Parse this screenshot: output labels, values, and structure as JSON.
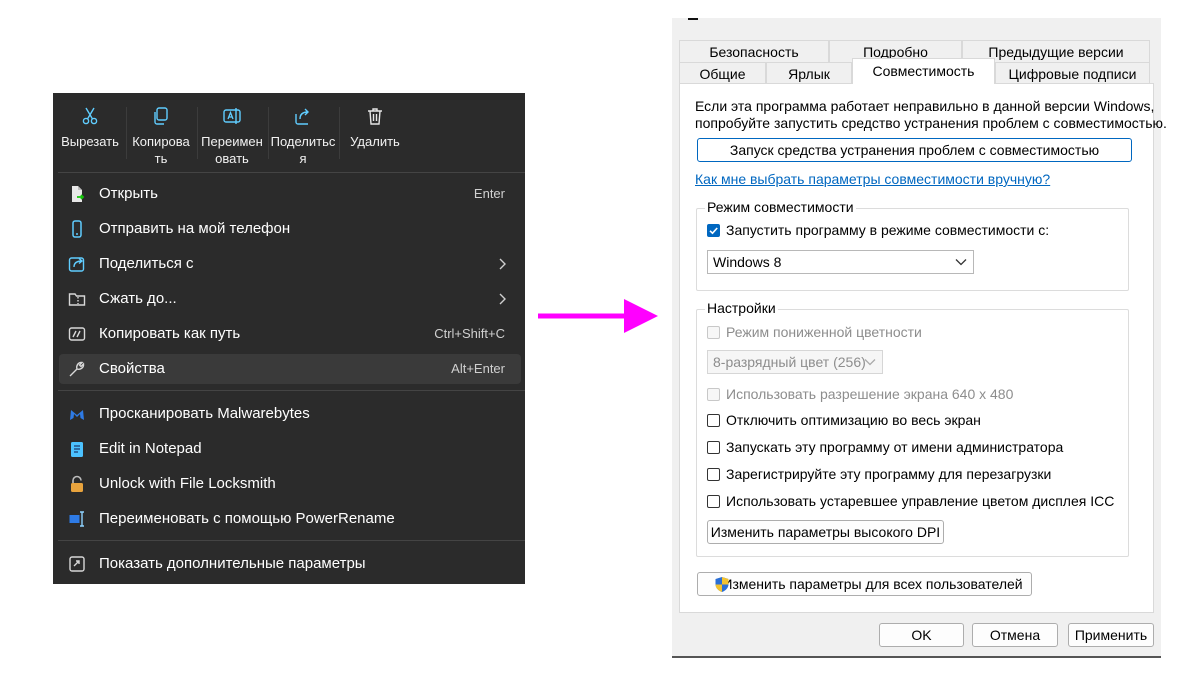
{
  "context_menu": {
    "toolbar": [
      {
        "icon": "cut-icon",
        "label": "Вырезать"
      },
      {
        "icon": "copy-icon",
        "label": "Копирова\nть"
      },
      {
        "icon": "rename-icon",
        "label": "Переимен\nовать"
      },
      {
        "icon": "share-icon",
        "label": "Поделитьс\nя"
      },
      {
        "icon": "trash-icon",
        "label": "Удалить"
      }
    ],
    "items": [
      {
        "icon": "open-file-icon",
        "label": "Открыть",
        "shortcut": "Enter"
      },
      {
        "icon": "phone-icon",
        "label": "Отправить на мой телефон"
      },
      {
        "icon": "share-icon",
        "label": "Поделиться с"
      },
      {
        "icon": "zip-folder-icon",
        "label": "Сжать до..."
      },
      {
        "icon": "copy-path-icon",
        "label": "Копировать как путь",
        "shortcut": "Ctrl+Shift+C"
      },
      {
        "icon": "wrench-icon",
        "label": "Свойства",
        "shortcut": "Alt+Enter"
      },
      {
        "icon": "malwarebytes-icon",
        "label": "Просканировать Malwarebytes"
      },
      {
        "icon": "notepad-icon",
        "label": "Edit in Notepad"
      },
      {
        "icon": "lock-icon",
        "label": "Unlock with File Locksmith"
      },
      {
        "icon": "powerrename-icon",
        "label": "Переименовать с помощью PowerRename"
      },
      {
        "icon": "more-options-icon",
        "label": "Показать дополнительные параметры"
      }
    ]
  },
  "dialog": {
    "tabs_row1": [
      "Безопасность",
      "Подробно",
      "Предыдущие версии"
    ],
    "tabs_row2": [
      "Общие",
      "Ярлык",
      "Совместимость",
      "Цифровые подписи"
    ],
    "intro_line1": "Если эта программа работает неправильно в данной версии Windows,",
    "intro_line2": "попробуйте запустить средство устранения проблем с совместимостью.",
    "troubleshoot_button": "Запуск средства устранения проблем с совместимостью",
    "manual_link": "Как мне выбрать параметры совместимости вручную?",
    "compat_group": {
      "title": "Режим совместимости",
      "checkbox_label": "Запустить программу в режиме совместимости с:",
      "selected_os": "Windows 8"
    },
    "settings_group": {
      "title": "Настройки",
      "reduced_color": "Режим пониженной цветности",
      "color_depth": "8-разрядный цвет (256)",
      "res_640": "Использовать разрешение экрана 640 x 480",
      "disable_fullscreen_opt": "Отключить оптимизацию во весь экран",
      "run_as_admin": "Запускать эту программу от имени администратора",
      "register_restart": "Зарегистрируйте эту программу для перезагрузки",
      "legacy_icc": "Использовать устаревшее управление цветом дисплея ICC",
      "high_dpi_button": "Изменить параметры высокого DPI"
    },
    "all_users_button": "Изменить параметры для всех пользователей",
    "ok_button": "OK",
    "cancel_button": "Отмена",
    "apply_button": "Применить"
  },
  "colors": {
    "arrow": "#ff00ff",
    "menu_bg": "#2b2b2b",
    "accent": "#0067c0"
  }
}
